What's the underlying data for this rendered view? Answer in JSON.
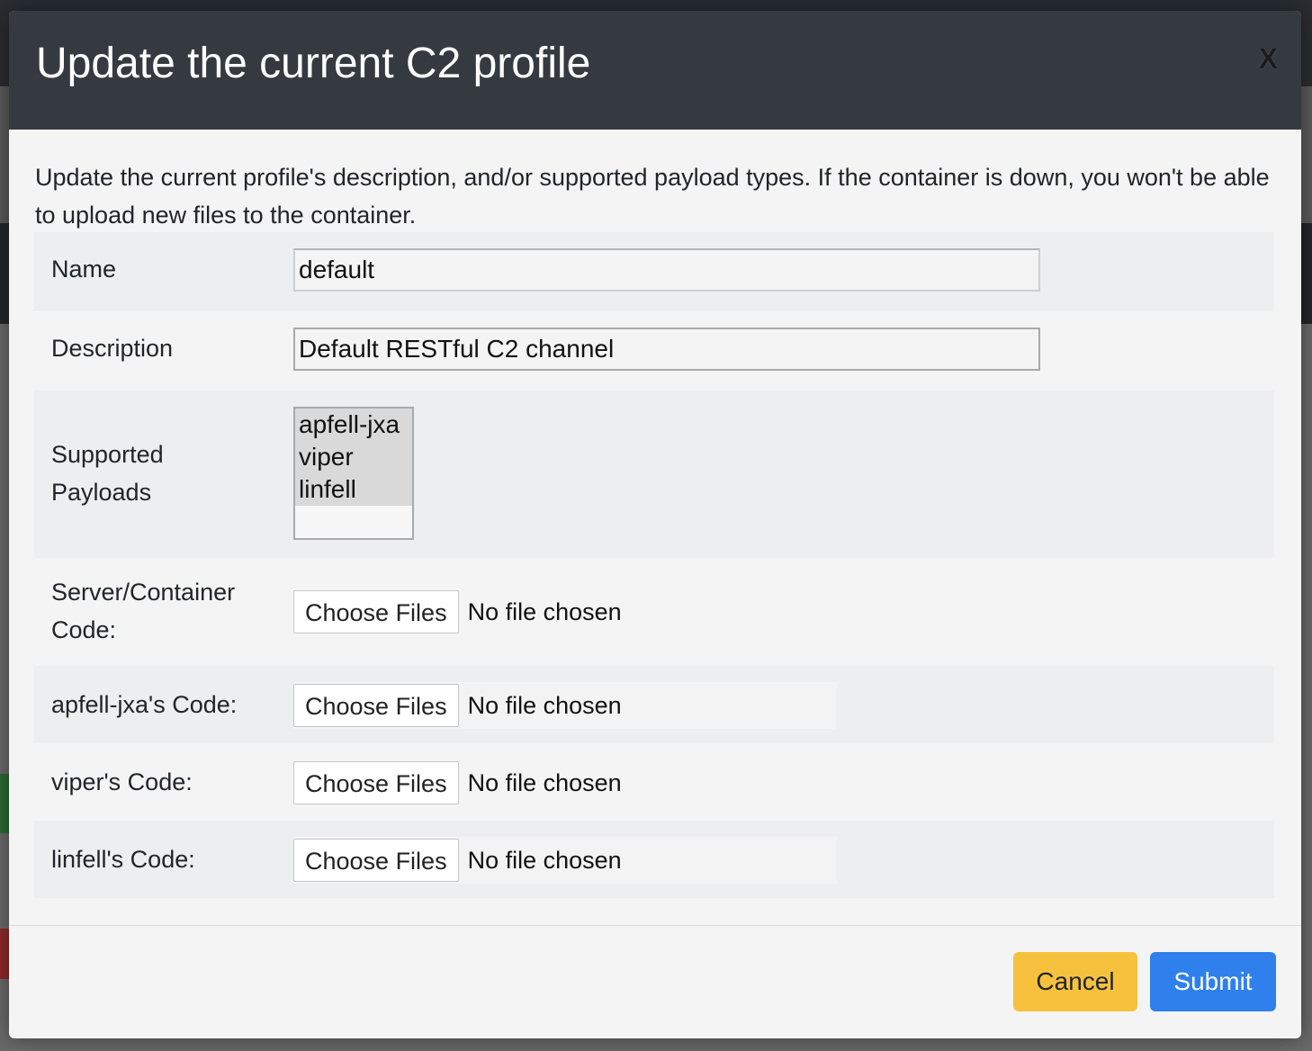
{
  "modal": {
    "title": "Update the current C2 profile",
    "close_label": "X",
    "intro": "Update the current profile's description, and/or supported payload types. If the container is down, you won't be able to upload new files to the container."
  },
  "form": {
    "name": {
      "label": "Name",
      "value": "default"
    },
    "description": {
      "label": "Description",
      "value": "Default RESTful C2 channel"
    },
    "payloads": {
      "label": "Supported Payloads",
      "options": [
        "apfell-jxa",
        "viper",
        "linfell"
      ]
    },
    "server_code": {
      "label": "Server/Container Code:",
      "button": "Choose Files",
      "status": "No file chosen"
    },
    "apfell_code": {
      "label": "apfell-jxa's Code:",
      "button": "Choose Files",
      "status": "No file chosen"
    },
    "viper_code": {
      "label": "viper's Code:",
      "button": "Choose Files",
      "status": "No file chosen"
    },
    "linfell_code": {
      "label": "linfell's Code:",
      "button": "Choose Files",
      "status": "No file chosen"
    }
  },
  "footer": {
    "cancel": "Cancel",
    "submit": "Submit"
  },
  "colors": {
    "header_bg": "#343a40",
    "cancel_bg": "#f6c23e",
    "submit_bg": "#2f80ed"
  }
}
